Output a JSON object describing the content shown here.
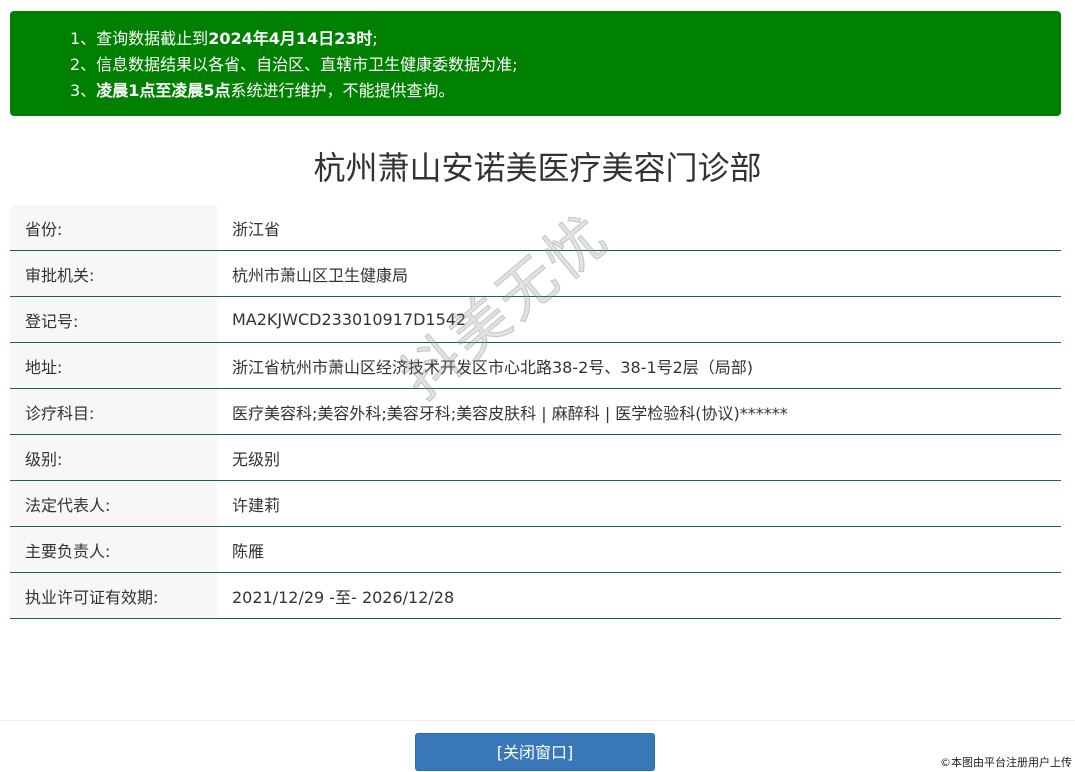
{
  "notice": {
    "line1": {
      "prefix": "1、查询数据截止到",
      "bold": "2024年4月14日23时",
      "suffix": ";"
    },
    "line2": {
      "text": "2、信息数据结果以各省、自治区、直辖市卫生健康委数据为准;"
    },
    "line3": {
      "prefix": "3、",
      "bold": "凌晨1点至凌晨5点",
      "suffix": "系统进行维护，不能提供查询。"
    }
  },
  "title": "杭州萧山安诺美医疗美容门诊部",
  "rows": [
    {
      "label": "省份:",
      "value": "浙江省"
    },
    {
      "label": "审批机关:",
      "value": "杭州市萧山区卫生健康局"
    },
    {
      "label": "登记号:",
      "value": "MA2KJWCD233010917D1542"
    },
    {
      "label": "地址:",
      "value": "浙江省杭州市萧山区经济技术开发区市心北路38-2号、38-1号2层（局部)"
    },
    {
      "label": "诊疗科目:",
      "value": "医疗美容科;美容外科;美容牙科;美容皮肤科 | 麻醉科 | 医学检验科(协议)******"
    },
    {
      "label": "级别:",
      "value": "无级别"
    },
    {
      "label": "法定代表人:",
      "value": "许建莉"
    },
    {
      "label": "主要负责人:",
      "value": "陈雁"
    },
    {
      "label": "执业许可证有效期:",
      "value": "2021/12/29 -至- 2026/12/28"
    }
  ],
  "close_button": "[关闭窗口]",
  "watermark": "抖美无忧",
  "credit": "©本图由平台注册用户上传",
  "colors": {
    "notice_bg": "#008000",
    "button_bg": "#3978b8",
    "row_border": "#1f5f5a",
    "label_bg": "#f7f7f7"
  }
}
